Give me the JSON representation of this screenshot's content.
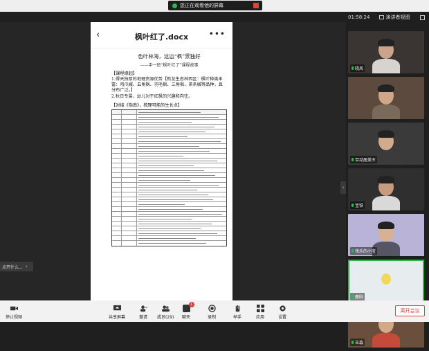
{
  "top_bar": {
    "sharing_text": "您正在观看他的屏幕"
  },
  "status_row": {
    "timer": "01:58:24",
    "view_label": "演讲者视图"
  },
  "document": {
    "title": "枫叶红了.docx",
    "heading": "色叶林海，这边“枫”景独好",
    "subheading": "——中一班“枫叶红了”课程故事",
    "section1": "【课程缘起】",
    "para1": "1.得天独厚的地理资源优势【新龙生态林西区：枫叶种类丰富：鸡爪槭、五角枫、羽毛枫、三角枫、茶条槭等品种，且分布广泛。】",
    "para2": "2.秋日专属，幼儿对于红枫的兴趣和向往。",
    "section2": "【对接《指南》，梳理可能的生长点】"
  },
  "side_toast": {
    "text": "点开什么..."
  },
  "participants": [
    {
      "name": "晓风",
      "skin": "#c9a48a",
      "bg": "#3a3533",
      "body": "#d7d3cf"
    },
    {
      "name": "",
      "skin": "#cfa686",
      "bg": "#5b4a3d",
      "body": "#7a6a5a"
    },
    {
      "name": "百动居美王",
      "skin": "#d2ab8c",
      "bg": "#3a3a3a",
      "body": "#3b3b3b"
    },
    {
      "name": "宝铁",
      "skin": "#c79b7d",
      "bg": "#2f2f2f",
      "body": "#d9d9d9"
    },
    {
      "name": "快乐的小宝",
      "skin": "#d8b193",
      "bg": "#b9b3d8",
      "body": "#556"
    },
    {
      "name": "鹿陆",
      "skin": "#f3d75a",
      "bg": "#e7ecef",
      "body": "#e7ecef"
    },
    {
      "name": "王淼",
      "skin": "#d3a987",
      "bg": "#6a4f3c",
      "body": "#c44a3a"
    }
  ],
  "toolbar": {
    "stop_video": "停止视频",
    "share_screen": "共享屏幕",
    "invite": "邀请",
    "members": "成员(29)",
    "chat": "聊天",
    "record": "录制",
    "raise_hand": "举手",
    "apps": "应用",
    "settings": "设置",
    "leave": "离开会议",
    "chat_badge": "1"
  },
  "colors": {
    "accent": "#2db84d",
    "danger": "#e04040"
  }
}
